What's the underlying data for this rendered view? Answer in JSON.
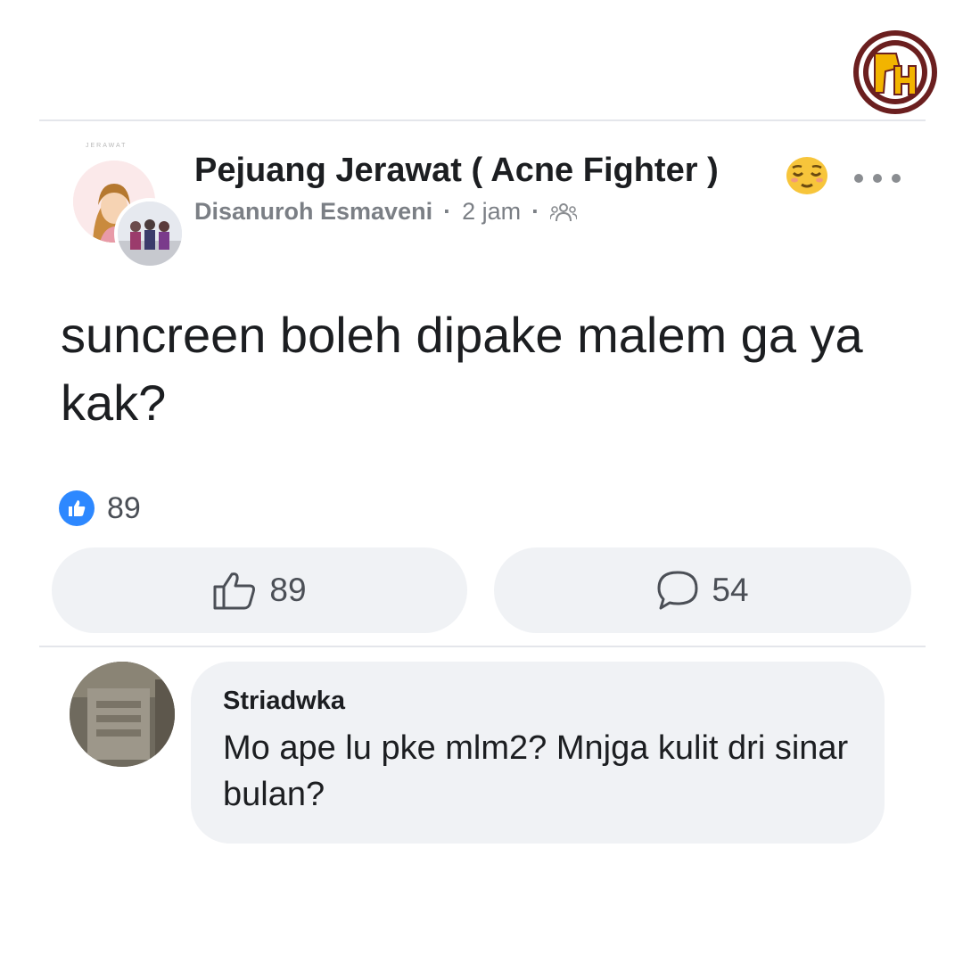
{
  "watermark": {
    "letters": "PH",
    "colors": {
      "ring": "#6b1f1f",
      "fill": "#f2b400"
    }
  },
  "post": {
    "group_name": "Pejuang Jerawat ( Acne Fighter )",
    "group_avatar_tag": "JERAWAT",
    "author": "Disanuroh Esmaveni",
    "separator": "·",
    "time": "2 jam",
    "audience_icon": "group-audience-icon",
    "title_emoji": "relieved-face-emoji",
    "body": "suncreen boleh dipake malem ga ya kak?",
    "reaction_icon": "like-reaction-icon",
    "reaction_count": "89"
  },
  "actions": {
    "like": {
      "icon": "thumbs-up-outline-icon",
      "label": "89"
    },
    "comment": {
      "icon": "speech-bubble-icon",
      "label": "54"
    }
  },
  "comment": {
    "author": "Striadwka",
    "text": "Mo ape lu pke mlm2? Mnjga kulit dri sinar bulan?"
  },
  "colors": {
    "text_primary": "#1c1e21",
    "text_secondary": "#7b7f85",
    "button_bg": "#f0f2f5",
    "like_blue": "#2d88ff",
    "divider": "#e4e6eb"
  }
}
